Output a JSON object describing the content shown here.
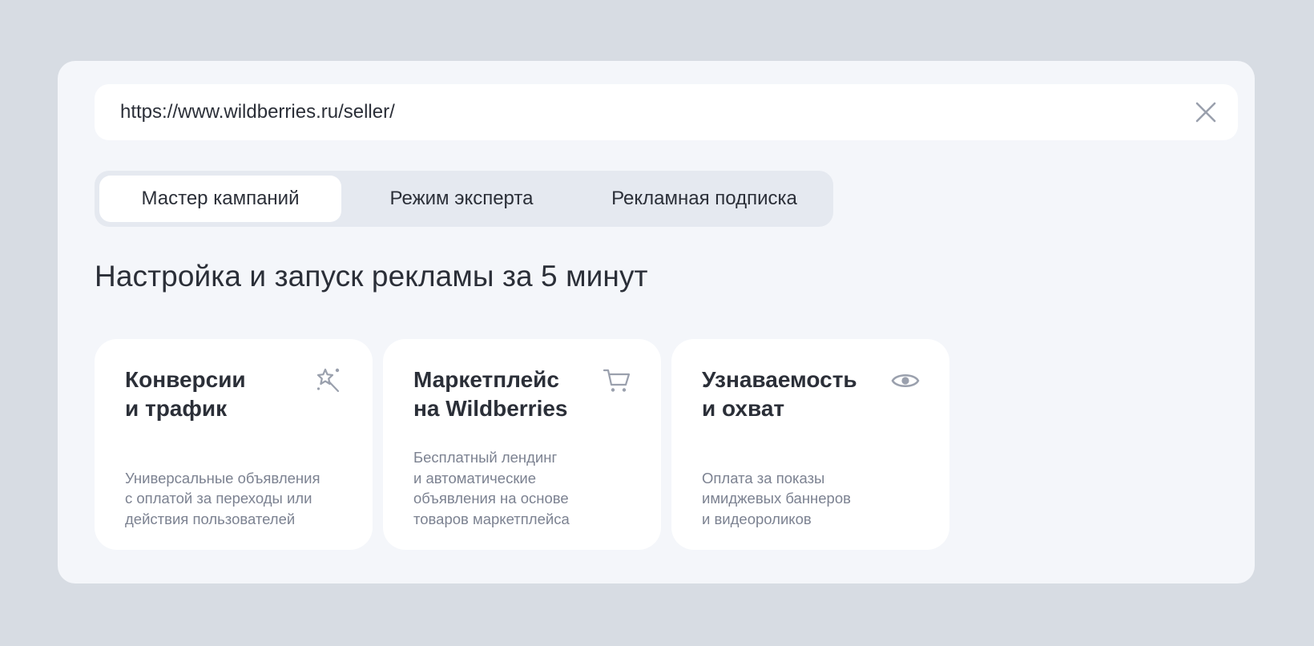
{
  "url_bar": {
    "value": "https://www.wildberries.ru/seller/",
    "close_icon": "close-icon"
  },
  "tabs": [
    {
      "label": "Мастер кампаний",
      "active": true
    },
    {
      "label": "Режим эксперта",
      "active": false
    },
    {
      "label": "Рекламная подписка",
      "active": false
    }
  ],
  "heading": "Настройка и запуск рекламы за 5 минут",
  "cards": [
    {
      "title_lines": [
        "Конверсии",
        "и трафик"
      ],
      "icon": "magic-wand-icon",
      "desc_lines": [
        "Универсальные объявления",
        "с оплатой за переходы или",
        "действия пользователей"
      ]
    },
    {
      "title_lines": [
        "Маркетплейс",
        "на Wildberries"
      ],
      "icon": "shopping-cart-icon",
      "desc_lines": [
        "Бесплатный лендинг",
        "и автоматические",
        "объявления на основе",
        "товаров маркетплейса"
      ]
    },
    {
      "title_lines": [
        "Узнаваемость",
        "и охват"
      ],
      "icon": "eye-icon",
      "desc_lines": [
        "Оплата за показы",
        "имиджевых баннеров",
        "и видеороликов"
      ]
    }
  ],
  "colors": {
    "page_background": "#d7dce3",
    "panel_background": "#f4f6fa",
    "tabs_background": "#e5e9f0",
    "text_primary": "#2b2f38",
    "text_secondary": "#7c8291",
    "icon_color": "#9aa0ad"
  }
}
